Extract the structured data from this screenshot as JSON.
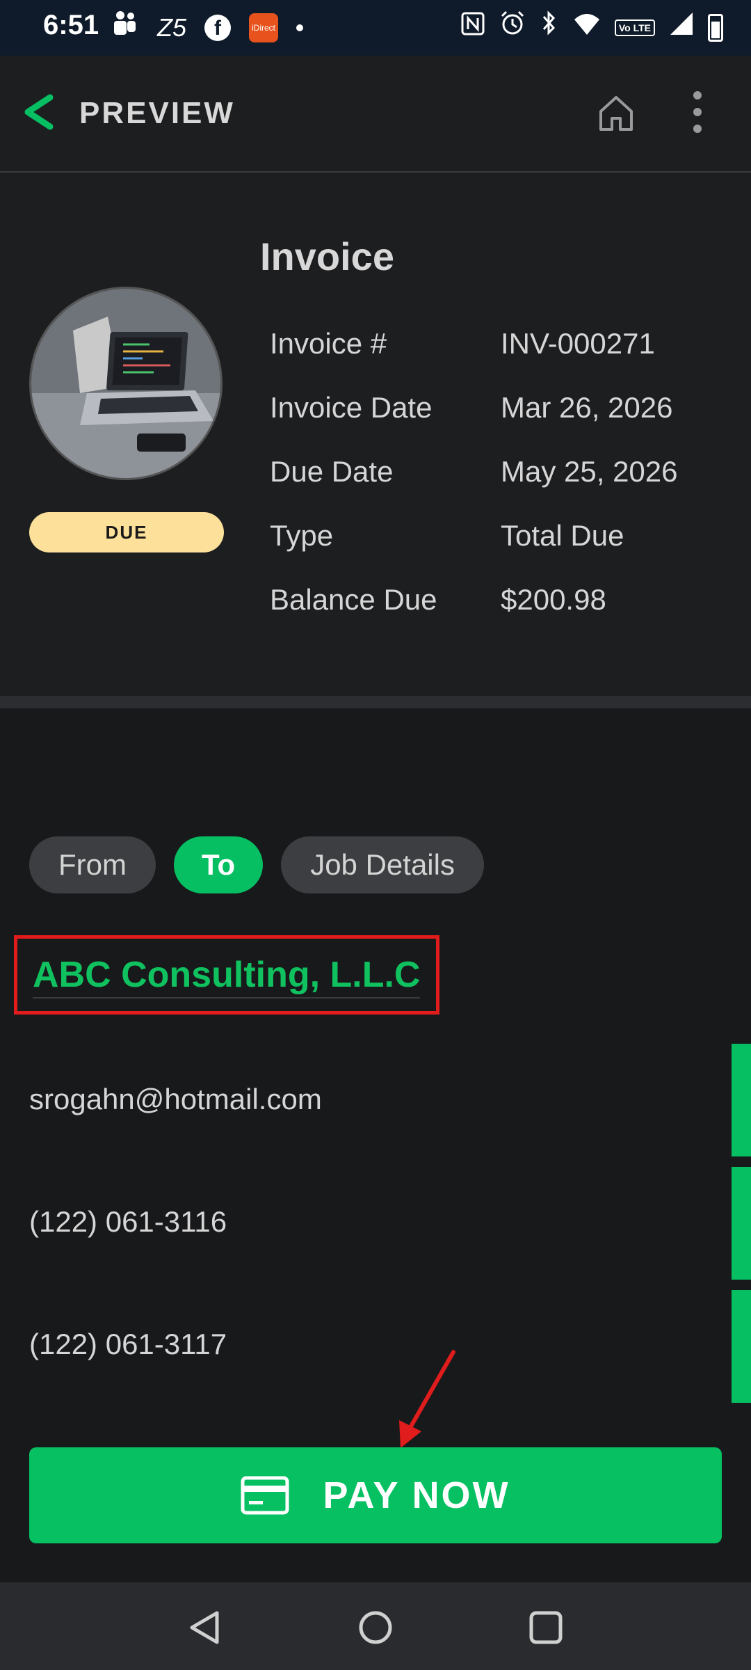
{
  "status_bar": {
    "time": "6:51",
    "left_icons": [
      "teams-icon",
      "zee5-icon",
      "facebook-icon",
      "icici-direct-icon",
      "notification-dot"
    ],
    "right_icons": [
      "nfc-icon",
      "alarm-icon",
      "bluetooth-icon",
      "wifi-icon",
      "volte-icon",
      "signal-icon",
      "battery-icon"
    ],
    "volte_text": "Vo LTE",
    "app_icon_text": "iDirect"
  },
  "top_bar": {
    "title": "PREVIEW",
    "accent_color": "#06bf62"
  },
  "invoice": {
    "heading": "Invoice",
    "status_badge": "DUE",
    "details": [
      {
        "label": "Invoice #",
        "value": "INV-000271"
      },
      {
        "label": "Invoice Date",
        "value": "Mar 26, 2026"
      },
      {
        "label": "Due Date",
        "value": "May 25, 2026"
      },
      {
        "label": "Type",
        "value": "Total Due"
      },
      {
        "label": "Balance Due",
        "value": "$200.98"
      }
    ]
  },
  "tabs": [
    {
      "label": "From",
      "active": false
    },
    {
      "label": "To",
      "active": true
    },
    {
      "label": "Job Details",
      "active": false
    }
  ],
  "recipient": {
    "company": "ABC Consulting, L.L.C",
    "email": "srogahn@hotmail.com",
    "phone_1": "(122) 061-3116",
    "phone_2": "(122) 061-3117"
  },
  "pay_button": {
    "label": "PAY NOW",
    "color": "#06c062"
  },
  "colors": {
    "highlight_box": "#e01c1c",
    "badge_bg": "#fde19a",
    "background": "#18191b"
  }
}
